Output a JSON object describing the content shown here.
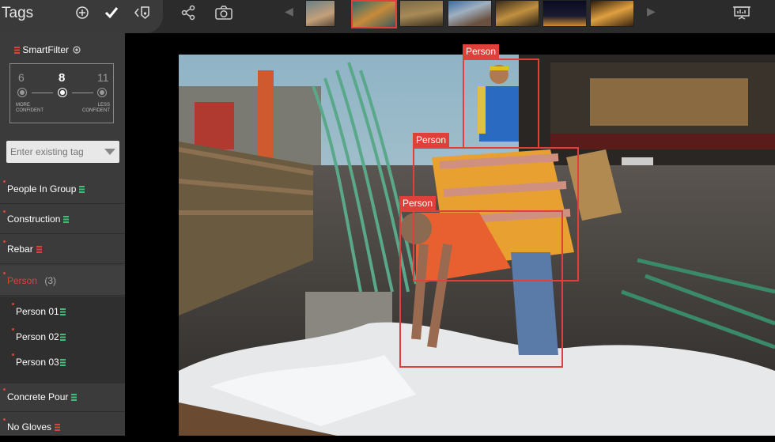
{
  "header": {
    "title": "Tags"
  },
  "smartfilter": {
    "title": "SmartFilter",
    "levels": [
      "6",
      "8",
      "11"
    ],
    "current": "8",
    "more_label": "MORE CONFIDENT",
    "less_label": "LESS CONFIDENT"
  },
  "tag_input": {
    "placeholder": "Enter existing tag"
  },
  "tags": [
    {
      "label": "People In Group",
      "color": "#3dbf7a"
    },
    {
      "label": "Construction",
      "color": "#3dbf7a"
    },
    {
      "label": "Rebar",
      "color": "#e0403a"
    },
    {
      "label": "Person",
      "count": "(3)",
      "color": "#e0403a"
    },
    {
      "label": "Person 01",
      "color": "#3dbf7a"
    },
    {
      "label": "Person 02",
      "color": "#3dbf7a"
    },
    {
      "label": "Person 03",
      "color": "#3dbf7a"
    },
    {
      "label": "Concrete Pour",
      "color": "#3dbf7a"
    },
    {
      "label": "No Gloves",
      "color": "#e0403a"
    }
  ],
  "detections": [
    {
      "label": "Person"
    },
    {
      "label": "Person"
    },
    {
      "label": "Person"
    }
  ],
  "colors": {
    "accent": "#e0403a",
    "tag_green": "#3dbf7a"
  }
}
